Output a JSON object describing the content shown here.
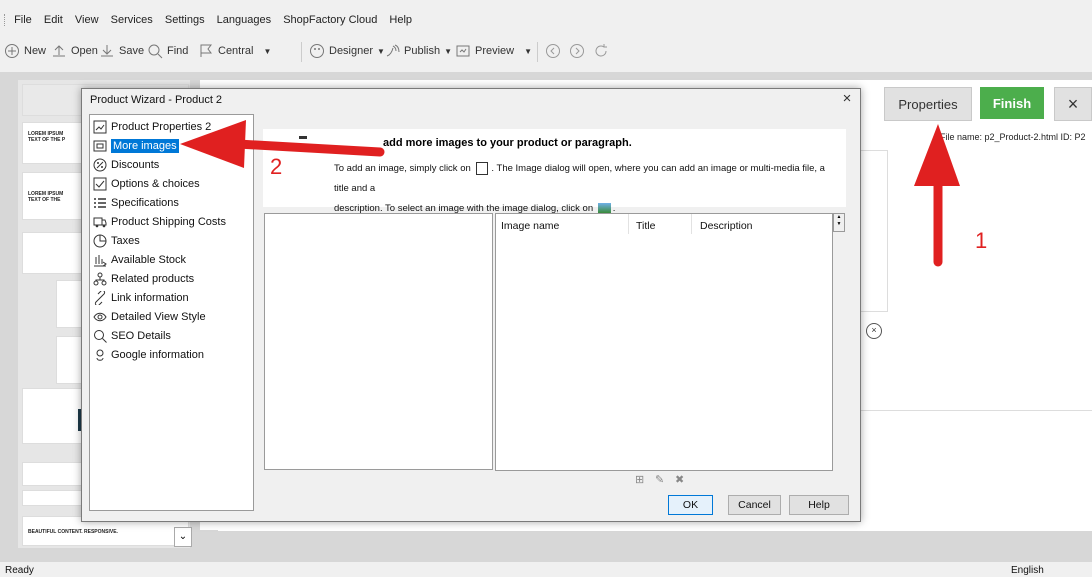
{
  "menu": [
    "File",
    "Edit",
    "View",
    "Services",
    "Settings",
    "Languages",
    "ShopFactory Cloud",
    "Help"
  ],
  "toolbar": {
    "new": "New",
    "open": "Open",
    "save": "Save",
    "find": "Find",
    "central": "Central",
    "designer": "Designer",
    "publish": "Publish",
    "preview": "Preview"
  },
  "topbar": {
    "properties": "Properties",
    "finish": "Finish",
    "close": "×",
    "file_info": "File name: p2_Product-2.html    ID: P2"
  },
  "thumbs": [
    "LOREM IPSUM",
    "TEXT OF THE P",
    "LOREM IPSUM",
    "TEXT OF THE",
    "BEAUTIFUL CONTENT. RESPONSIVE."
  ],
  "dialog": {
    "title": "Product Wizard - Product 2",
    "close": "×",
    "nav": [
      {
        "label": "Product Properties 2",
        "icon": "properties-icon"
      },
      {
        "label": "More images",
        "icon": "images-icon",
        "selected": true
      },
      {
        "label": "Discounts",
        "icon": "percent-icon"
      },
      {
        "label": "Options & choices",
        "icon": "checkbox-icon"
      },
      {
        "label": "Specifications",
        "icon": "list-icon"
      },
      {
        "label": "Product Shipping Costs",
        "icon": "truck-icon"
      },
      {
        "label": "Taxes",
        "icon": "pie-icon"
      },
      {
        "label": "Available Stock",
        "icon": "stock-icon"
      },
      {
        "label": "Related products",
        "icon": "tree-icon"
      },
      {
        "label": "Link information",
        "icon": "link-icon"
      },
      {
        "label": "Detailed View Style",
        "icon": "eye-icon"
      },
      {
        "label": "SEO Details",
        "icon": "search-icon"
      },
      {
        "label": "Google information",
        "icon": "google-icon"
      }
    ],
    "info_heading": "add more images to your product or paragraph.",
    "info_line1a": "To add an image, simply click on",
    "info_line1b": ". The Image dialog will open, where you can add an image or multi-media file, a title and a",
    "info_line2a": "description. To select an image with the image dialog, click on",
    "info_line2b": ".",
    "columns": [
      "Image name",
      "Title",
      "Description"
    ],
    "ok": "OK",
    "cancel": "Cancel",
    "help": "Help"
  },
  "annotations": {
    "one": "1",
    "two": "2"
  },
  "colors": {
    "accent": "#0078d7",
    "finish": "#4cae4c",
    "arrow": "#e02020"
  },
  "status": {
    "left": "Ready",
    "right": "English"
  }
}
